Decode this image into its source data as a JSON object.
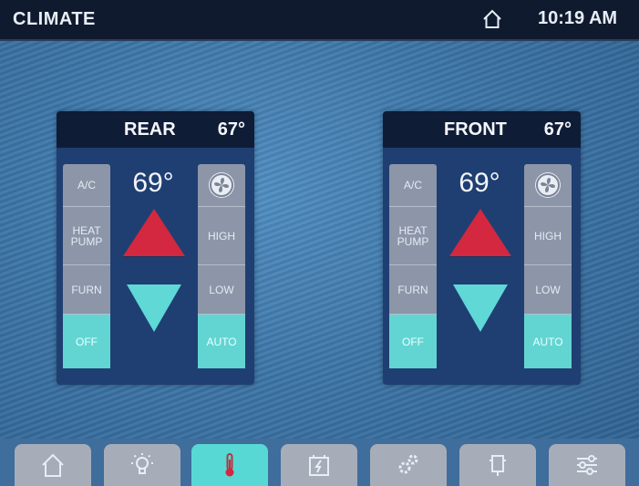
{
  "header": {
    "title": "CLIMATE",
    "home_icon": "home-icon",
    "time": "10:19 AM"
  },
  "zones": [
    {
      "name": "REAR",
      "current_temp": "67°",
      "setpoint": "69°",
      "modes": [
        "A/C",
        "HEAT PUMP",
        "FURN",
        "OFF"
      ],
      "active_mode": "OFF",
      "fan_icon": "fan-icon",
      "fan_speeds": [
        "HIGH",
        "LOW",
        "AUTO"
      ],
      "active_fan_speed": "AUTO"
    },
    {
      "name": "FRONT",
      "current_temp": "67°",
      "setpoint": "69°",
      "modes": [
        "A/C",
        "HEAT PUMP",
        "FURN",
        "OFF"
      ],
      "active_mode": "OFF",
      "fan_icon": "fan-icon",
      "fan_speeds": [
        "HIGH",
        "LOW",
        "AUTO"
      ],
      "active_fan_speed": "AUTO"
    }
  ],
  "nav": {
    "items": [
      {
        "icon": "home-icon"
      },
      {
        "icon": "light-bulb-icon"
      },
      {
        "icon": "thermometer-icon",
        "active": true
      },
      {
        "icon": "battery-power-icon"
      },
      {
        "icon": "gears-icon"
      },
      {
        "icon": "generator-icon"
      },
      {
        "icon": "sliders-settings-icon"
      }
    ]
  },
  "colors": {
    "active": "#58d8d5",
    "up_arrow": "#d3283f",
    "down_arrow": "#5fd8d6",
    "header_bg": "#101a2e",
    "panel_bg": "#1f3f72"
  }
}
